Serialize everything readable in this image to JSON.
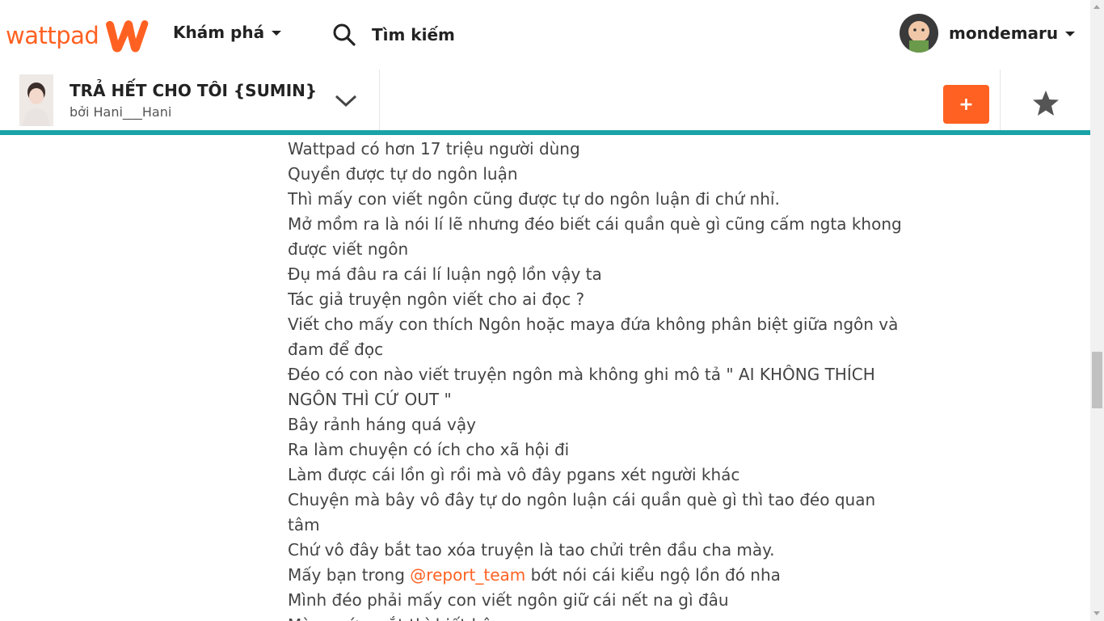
{
  "header": {
    "logo_text": "wattpad",
    "discover_label": "Khám phá",
    "search_label": "Tìm kiếm",
    "username": "mondemaru"
  },
  "story": {
    "title": "TRẢ HẾT CHO TÔI {SUMIN}",
    "author": "bởi Hani___Hani",
    "add_label": "+"
  },
  "content": {
    "lines": [
      "Wattpad có hơn 17 triệu người dùng",
      "Quyền được tự do ngôn luận",
      "Thì mấy con viết ngôn cũng được tự do ngôn luận đi chứ nhỉ.",
      "Mở mồm ra là nói lí lẽ nhưng đéo biết cái quần què gì cũng cấm ngta khong được viết ngôn",
      "Đụ má đâu ra cái lí luận ngộ lồn vậy ta",
      "Tác giả truyện ngôn viết cho ai đọc ?",
      "Viết cho mấy con thích Ngôn hoặc maya đứa không phân biệt giữa ngôn và đam để đọc",
      "Đéo có con nào viết truyện ngôn mà không ghi mô tả \" AI KHÔNG THÍCH NGÔN THÌ CỨ OUT \"",
      "Bây rảnh háng quá vậy",
      "Ra làm chuyện có ích cho xã hội đi",
      "Làm được cái lồn gì rồi mà vô đây pgans xét người khác",
      "Chuyện mà bây vô đây tự do ngôn luận cái quần què gì thì tao đéo quan tâm",
      "Chứ vô đây bắt tao xóa truyện là tao chửi trên đầu cha mày."
    ],
    "mention_line": {
      "before": "Mấy bạn trong ",
      "mention": "@report_team",
      "after": " bớt nói cái kiểu ngộ lồn đó nha"
    },
    "lines_after": [
      "Mình đéo phải mấy con viết ngôn giữ cái nết na gì đâu",
      "Mày ngứa mắt thì biết hộ"
    ]
  },
  "colors": {
    "brand": "#ff6122",
    "teal": "#1aa3a7",
    "text": "#444444"
  },
  "icons": {
    "logo": "wattpad-w-icon",
    "search": "search-icon",
    "caret": "caret-down-icon",
    "chevron": "chevron-down-icon",
    "star": "star-icon"
  }
}
